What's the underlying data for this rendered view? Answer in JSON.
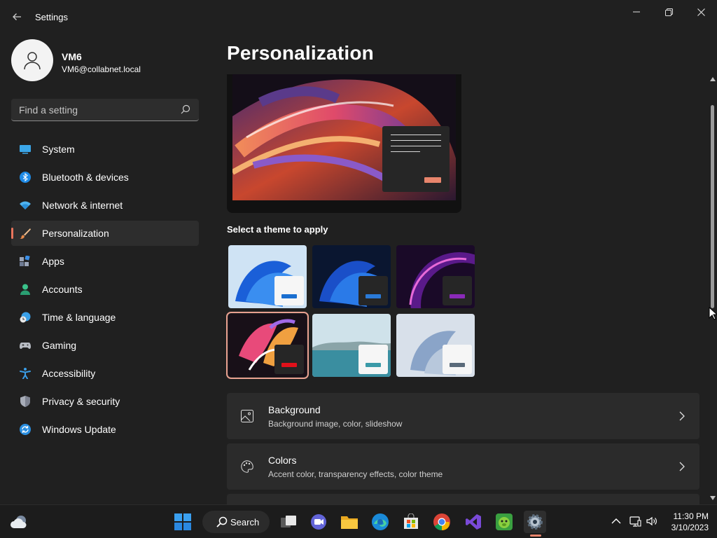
{
  "window": {
    "title": "Settings"
  },
  "profile": {
    "name": "VM6",
    "email": "VM6@collabnet.local"
  },
  "search": {
    "placeholder": "Find a setting"
  },
  "nav": {
    "items": [
      {
        "label": "System",
        "icon": "system-icon"
      },
      {
        "label": "Bluetooth & devices",
        "icon": "bluetooth-icon"
      },
      {
        "label": "Network & internet",
        "icon": "wifi-icon"
      },
      {
        "label": "Personalization",
        "icon": "brush-icon",
        "active": true
      },
      {
        "label": "Apps",
        "icon": "apps-icon"
      },
      {
        "label": "Accounts",
        "icon": "person-icon"
      },
      {
        "label": "Time & language",
        "icon": "clock-globe-icon"
      },
      {
        "label": "Gaming",
        "icon": "gamepad-icon"
      },
      {
        "label": "Accessibility",
        "icon": "accessibility-icon"
      },
      {
        "label": "Privacy & security",
        "icon": "shield-icon"
      },
      {
        "label": "Windows Update",
        "icon": "update-icon"
      }
    ]
  },
  "main": {
    "title": "Personalization",
    "theme_section_label": "Select a theme to apply",
    "cards": [
      {
        "title": "Background",
        "subtitle": "Background image, color, slideshow",
        "icon": "image-icon"
      },
      {
        "title": "Colors",
        "subtitle": "Accent color, transparency effects, color theme",
        "icon": "palette-icon"
      }
    ]
  },
  "taskbar": {
    "search_label": "Search",
    "clock_time": "11:30 PM",
    "clock_date": "3/10/2023"
  },
  "colors": {
    "accent": "#e8745c",
    "background": "#202020",
    "card": "#2b2b2b"
  }
}
